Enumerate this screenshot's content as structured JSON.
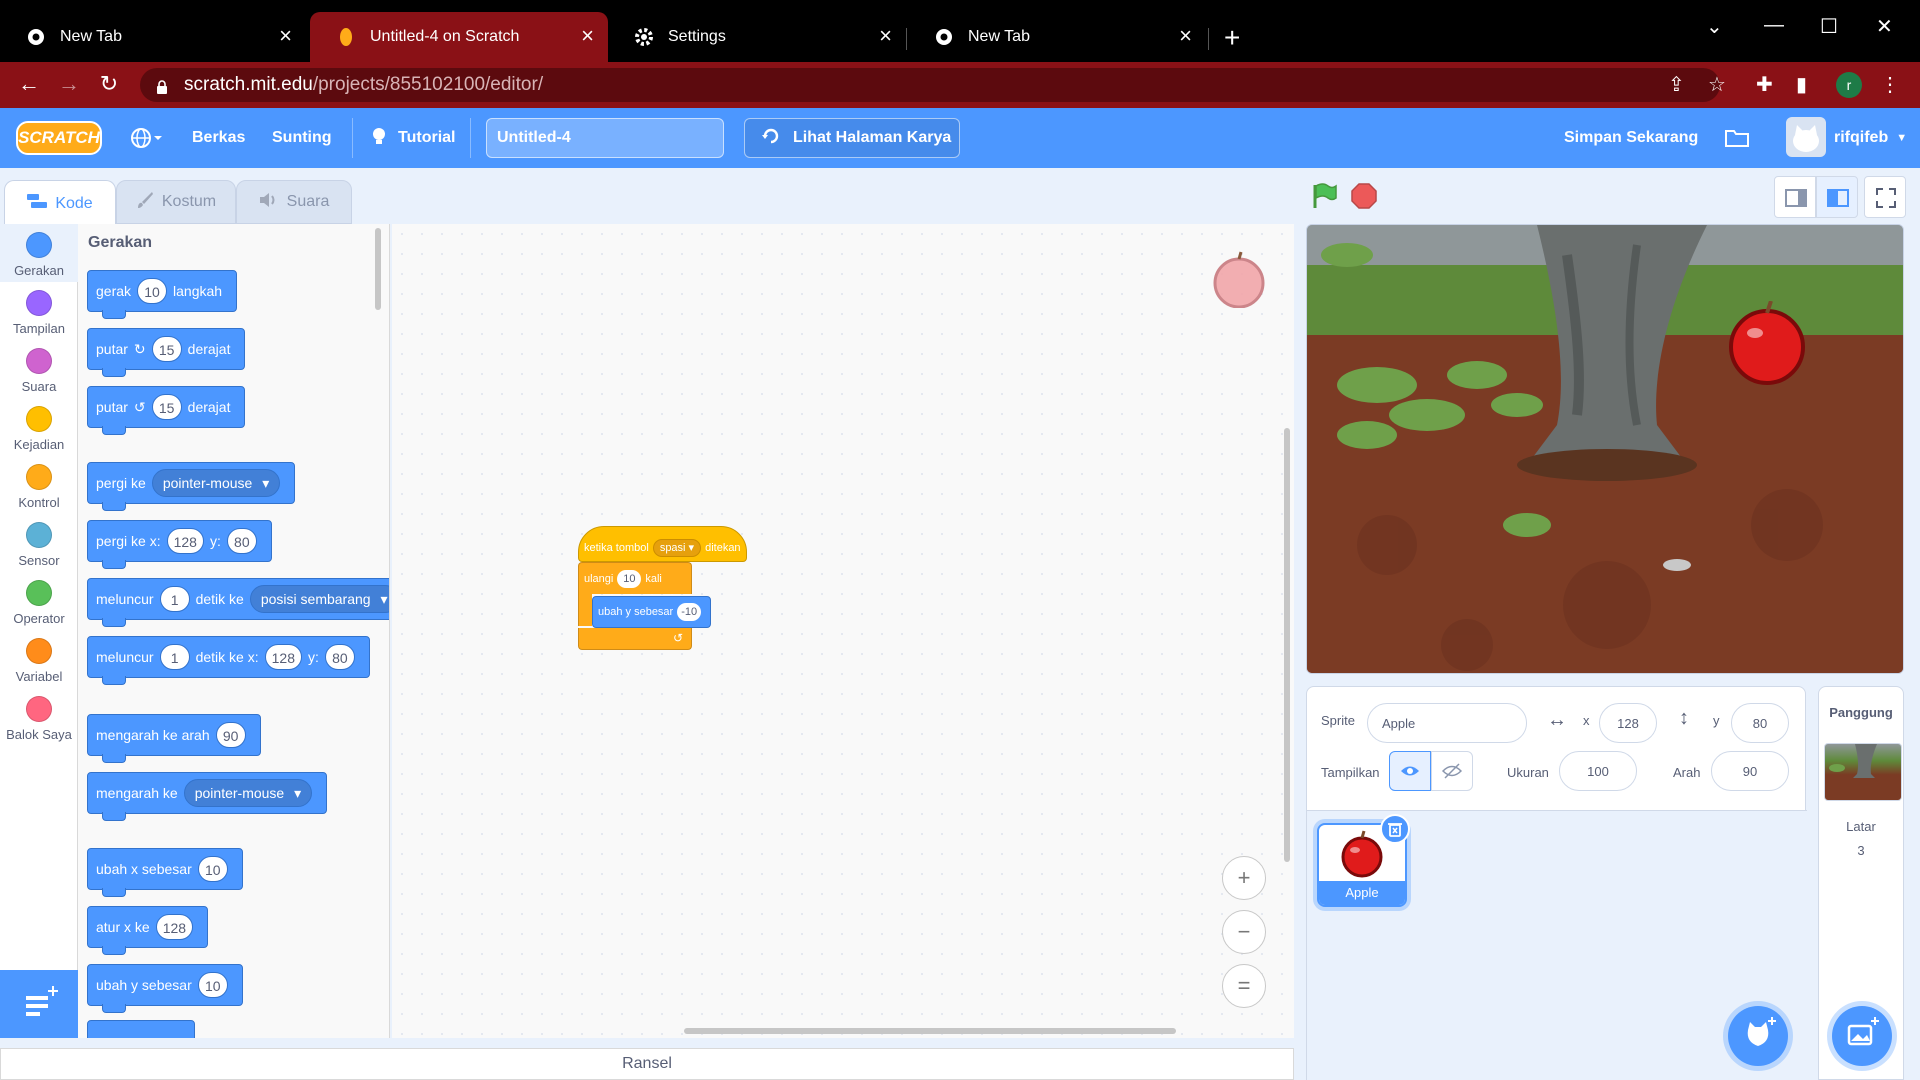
{
  "browser": {
    "tabs": [
      {
        "title": "New Tab"
      },
      {
        "title": "Untitled-4 on Scratch"
      },
      {
        "title": "Settings"
      },
      {
        "title": "New Tab"
      }
    ],
    "url_host": "scratch.mit.edu",
    "url_path": "/projects/855102100/editor/",
    "profile_initial": "r"
  },
  "menubar": {
    "logo": "SCRATCH",
    "file": "Berkas",
    "edit": "Sunting",
    "tutorial": "Tutorial",
    "project_title": "Untitled-4",
    "see_project": "Lihat Halaman Karya",
    "save_now": "Simpan Sekarang",
    "username": "rifqifeb"
  },
  "editor_tabs": {
    "code": "Kode",
    "costumes": "Kostum",
    "sounds": "Suara"
  },
  "categories": [
    {
      "label": "Gerakan",
      "color": "#4c97ff"
    },
    {
      "label": "Tampilan",
      "color": "#9966ff"
    },
    {
      "label": "Suara",
      "color": "#cf63cf"
    },
    {
      "label": "Kejadian",
      "color": "#ffbf00"
    },
    {
      "label": "Kontrol",
      "color": "#ffab19"
    },
    {
      "label": "Sensor",
      "color": "#5cb1d6"
    },
    {
      "label": "Operator",
      "color": "#59c059"
    },
    {
      "label": "Variabel",
      "color": "#ff8c1a"
    },
    {
      "label": "Balok Saya",
      "color": "#ff6680"
    }
  ],
  "palette": {
    "heading": "Gerakan",
    "move": {
      "label": "gerak",
      "value": "10",
      "suffix": "langkah"
    },
    "turn_right": {
      "label": "putar",
      "value": "15",
      "suffix": "derajat"
    },
    "turn_left": {
      "label": "putar",
      "value": "15",
      "suffix": "derajat"
    },
    "goto": {
      "label": "pergi ke",
      "option": "pointer-mouse"
    },
    "goto_xy": {
      "label": "pergi ke x:",
      "x": "128",
      "ylabel": "y:",
      "y": "80"
    },
    "glide_to": {
      "label": "meluncur",
      "secs": "1",
      "mid": "detik ke",
      "option": "posisi sembarang"
    },
    "glide_xy": {
      "label": "meluncur",
      "secs": "1",
      "mid": "detik ke x:",
      "x": "128",
      "ylabel": "y:",
      "y": "80"
    },
    "point_dir": {
      "label": "mengarah ke arah",
      "value": "90"
    },
    "point_towards": {
      "label": "mengarah ke",
      "option": "pointer-mouse"
    },
    "change_x": {
      "label": "ubah x sebesar",
      "value": "10"
    },
    "set_x": {
      "label": "atur x ke",
      "value": "128"
    },
    "change_y": {
      "label": "ubah y sebesar",
      "value": "10"
    }
  },
  "script": {
    "hat_prefix": "ketika tombol",
    "hat_key": "spasi",
    "hat_suffix": "ditekan",
    "repeat_label": "ulangi",
    "repeat_count": "10",
    "repeat_suffix": "kali",
    "inner_label": "ubah y sebesar",
    "inner_value": "-10"
  },
  "backpack": "Ransel",
  "sprite_info": {
    "sprite_label": "Sprite",
    "sprite_name": "Apple",
    "x_label": "x",
    "x": "128",
    "y_label": "y",
    "y": "80",
    "show_label": "Tampilkan",
    "size_label": "Ukuran",
    "size": "100",
    "direction_label": "Arah",
    "direction": "90"
  },
  "sprites": [
    {
      "name": "Apple"
    }
  ],
  "stage_pane": {
    "title": "Panggung",
    "backdrops_label": "Latar",
    "backdrops_count": "3"
  },
  "colors": {
    "motion": "#4c97ff",
    "events": "#ffbf00",
    "control": "#ffab19",
    "menubar": "#4c97ff",
    "browser_accent": "#8a1116"
  }
}
